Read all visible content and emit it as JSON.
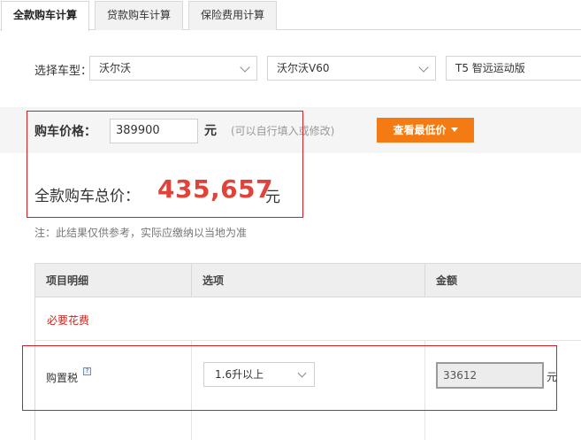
{
  "tabs": [
    {
      "label": "全款购车计算",
      "active": true
    },
    {
      "label": "贷款购车计算",
      "active": false
    },
    {
      "label": "保险费用计算",
      "active": false
    }
  ],
  "vehicle_select": {
    "label": "选择车型：",
    "brand": "沃尔沃",
    "series": "沃尔沃V60",
    "trim": "T5 智远运动版"
  },
  "price": {
    "label": "购车价格：",
    "value": "389900",
    "unit": "元",
    "hint": "(可以自行填入或修改)",
    "lowest_price_button": "查看最低价"
  },
  "total": {
    "label": "全款购车总价：",
    "value": "435,657",
    "unit": "元"
  },
  "note": "注：此结果仅供参考，实际应缴纳以当地为准",
  "table": {
    "headers": [
      "项目明细",
      "选项",
      "金额"
    ],
    "section_title": "必要花费",
    "rows": [
      {
        "item": "购置税",
        "help_icon": "?",
        "option": "1.6升以上",
        "amount": "33612",
        "unit": "元"
      }
    ]
  },
  "colors": {
    "accent": "#f47b13",
    "total_value": "#e0433a",
    "section_title": "#c8281e",
    "highlight_border": "#d42020"
  }
}
